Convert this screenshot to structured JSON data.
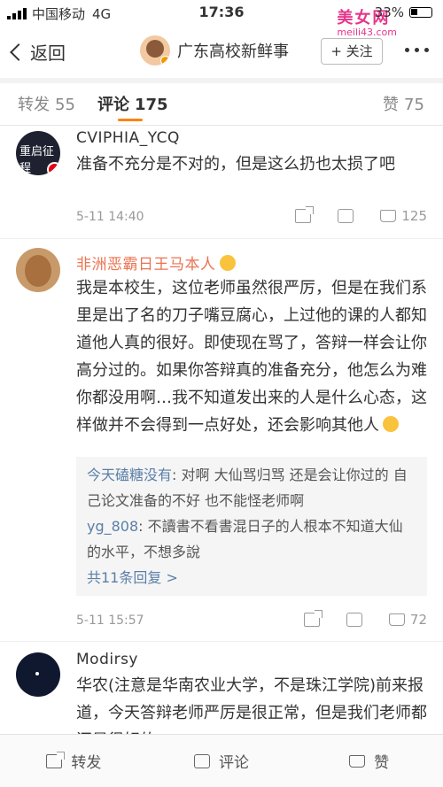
{
  "status_bar": {
    "carrier": "中国移动",
    "network": "4G",
    "time": "17:36",
    "battery": "33%",
    "watermark": "美女网",
    "watermark_url": "meili43.com"
  },
  "nav": {
    "back_label": "返回",
    "title": "广东高校新鲜事",
    "follow_label": "+ 关注"
  },
  "tabs": [
    {
      "label": "转发",
      "count": "55"
    },
    {
      "label": "评论",
      "count": "175"
    },
    {
      "label": "赞",
      "count": "75"
    }
  ],
  "comments": [
    {
      "username": "CVIPHIA_YCQ",
      "avatar_text": "重启征程",
      "text": "准备不充分是不对的，但是这么扔也太损了吧",
      "time": "5-11 14:40",
      "likes": "125"
    },
    {
      "username": "非洲恶霸日王马本人",
      "text": "我是本校生，这位老师虽然很严厉，但是在我们系里是出了名的刀子嘴豆腐心，上过他的课的人都知道他人真的很好。即使现在骂了，答辩一样会让你高分过的。如果你答辩真的准备充分，他怎么为难你都没用啊…我不知道发出来的人是什么心态，这样做并不会得到一点好处，还会影响其他人",
      "replies": [
        {
          "user": "今天磕糖没有",
          "text": "对啊 大仙骂归骂 还是会让你过的 自己论文准备的不好 也不能怪老师啊"
        },
        {
          "user": "yg_808",
          "text": "不讀書不看書混日子的人根本不知道大仙的水平，不想多說"
        }
      ],
      "more_replies": "共11条回复 >",
      "time": "5-11 15:57",
      "likes": "72"
    },
    {
      "username": "Modirsy",
      "text": "华农(注意是华南农业大学，不是珠江学院)前来报道，今天答辩老师严厉是很正常，但是我们老师都还是很好的"
    }
  ],
  "bottom_bar": {
    "repost": "转发",
    "comment": "评论",
    "like": "赞"
  }
}
